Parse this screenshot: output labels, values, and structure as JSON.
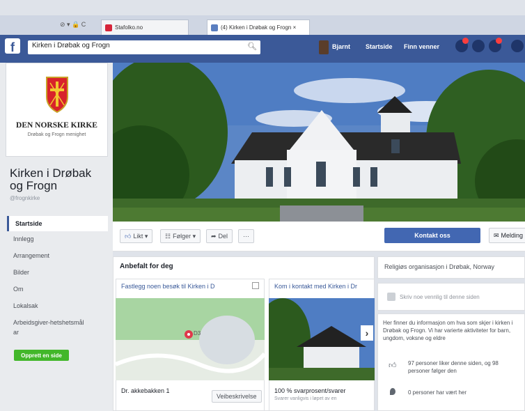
{
  "browser": {
    "address_bar": "⊘ ▾ 🔒 C",
    "tabs": [
      {
        "label": "Stafolko.no"
      },
      {
        "label": "(4) Kirken i Drøbak og Frogn ×"
      }
    ]
  },
  "fb_bar": {
    "logo": "f",
    "search_value": "Kirken i Drøbak og Frogn",
    "nav": {
      "profile": "Bjarnt",
      "home": "Startside",
      "friends": "Finn venner"
    },
    "colors": {
      "bar": "#3b5998",
      "accent": "#4267b2",
      "green": "#42b72a"
    }
  },
  "profile": {
    "org_name": "DEN NORSKE KIRKE",
    "org_sub": "Drøbak og Frogn menighet",
    "page_name": "Kirken i Drøbak og Frogn",
    "handle": "@frognkirke"
  },
  "left_nav": {
    "items": [
      {
        "label": "Startside"
      },
      {
        "label": "Innlegg"
      },
      {
        "label": "Arrangement"
      },
      {
        "label": "Bilder"
      },
      {
        "label": "Om"
      },
      {
        "label": "Lokalsak"
      },
      {
        "label": "Arbeidsgiver-hetshetsmål"
      },
      {
        "label": "ar"
      }
    ],
    "create_button": "Opprett en side"
  },
  "actions": {
    "like": "Likt ▾",
    "follow": "Følger ▾",
    "share": "Del",
    "more": "···",
    "contact": "Kontakt oss",
    "message": "Melding"
  },
  "suggested": {
    "heading": "Anbefalt for deg",
    "card1_title": "Fastlegg noen besøk til Kirken i D",
    "card1_address": "Dr. akkebakken 1",
    "card1_button": "Veibeskrivelse",
    "card1_map_label": "D3",
    "card2_title": "Kom i kontakt med Kirken i Dr",
    "card2_stat": "100 % svarprosent/svarer",
    "card2_sub": "Svarer vanligvis i løpet av en"
  },
  "right": {
    "category": "Religiøs organisasjon i Drøbak, Norway",
    "write_prompt": "Skriv noe vennlig til denne siden",
    "about": "Her finner du informasjon om hva som skjer i kirken i Drøbak og Frogn. Vi har varierte aktiviteter for barn, ungdom, voksne og eldre",
    "likes": "97 personer liker denne siden, og 98 personer følger den",
    "checkins": "0 personer har vært her"
  }
}
